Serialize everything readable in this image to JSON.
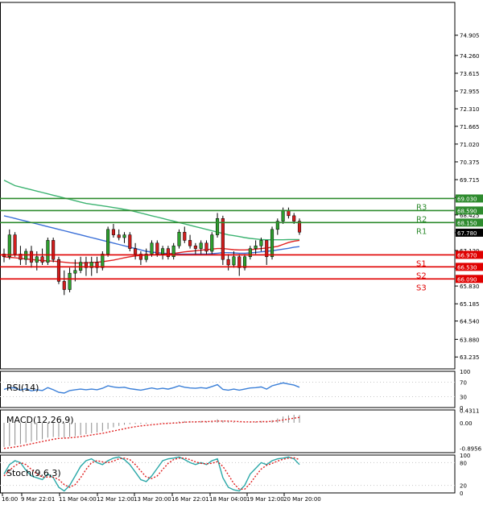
{
  "chart_data": [
    {
      "type": "candlestick",
      "ylim": [
        62.8,
        76.2
      ],
      "ticks": [
        75.0,
        74.26,
        73.61,
        72.96,
        72.31,
        71.67,
        71.02,
        70.37,
        69.72,
        69.07,
        68.43,
        67.78,
        67.13,
        66.48,
        65.83,
        65.18,
        64.55,
        63.88,
        63.235
      ],
      "tick_labels": [
        "74.905",
        "74.260",
        "73.615",
        "72.955",
        "72.310",
        "71.665",
        "71.020",
        "70.375",
        "69.715",
        "69.070",
        "68.425",
        "67.780",
        "67.120",
        "66.475",
        "65.830",
        "65.185",
        "64.540",
        "63.880",
        "63.235"
      ],
      "current_price": {
        "label": "67.780",
        "value": 67.78
      },
      "pivots": [
        {
          "name": "R3",
          "label": "69.030",
          "value": 69.03,
          "color": "#2e8b2e"
        },
        {
          "name": "R2",
          "label": "68.590",
          "value": 68.59,
          "color": "#2e8b2e"
        },
        {
          "name": "R1",
          "label": "68.150",
          "value": 68.15,
          "color": "#2e8b2e"
        },
        {
          "name": "S1",
          "label": "66.970",
          "value": 66.97,
          "color": "#e00000"
        },
        {
          "name": "S2",
          "label": "66.530",
          "value": 66.53,
          "color": "#e00000"
        },
        {
          "name": "S3",
          "label": "66.090",
          "value": 66.09,
          "color": "#e00000"
        }
      ],
      "x_labels": [
        "16:00",
        "9 Mar 22:01",
        "11 Mar 04:00",
        "12 Mar 12:00",
        "13 Mar 20:00",
        "16 Mar 22:01",
        "18 Mar 04:00",
        "19 Mar 12:00",
        "20 Mar 20:00"
      ],
      "candles": [
        [
          67.0,
          67.2,
          66.7,
          66.9
        ],
        [
          66.9,
          67.9,
          66.8,
          67.7
        ],
        [
          67.7,
          67.8,
          66.9,
          67.0
        ],
        [
          67.0,
          67.3,
          66.6,
          66.8
        ],
        [
          66.8,
          67.2,
          66.6,
          67.1
        ],
        [
          67.1,
          67.3,
          66.5,
          66.7
        ],
        [
          66.7,
          67.1,
          66.4,
          66.9
        ],
        [
          66.9,
          67.2,
          66.6,
          66.7
        ],
        [
          66.7,
          67.6,
          66.6,
          67.5
        ],
        [
          67.5,
          67.6,
          66.7,
          66.8
        ],
        [
          66.8,
          66.9,
          65.9,
          66.0
        ],
        [
          66.0,
          66.4,
          65.5,
          65.7
        ],
        [
          65.7,
          66.5,
          65.6,
          66.3
        ],
        [
          66.3,
          66.8,
          66.0,
          66.4
        ],
        [
          66.4,
          66.9,
          66.3,
          66.7
        ],
        [
          66.7,
          66.9,
          66.2,
          66.5
        ],
        [
          66.5,
          66.9,
          66.2,
          66.7
        ],
        [
          66.7,
          66.9,
          66.3,
          66.5
        ],
        [
          66.5,
          67.1,
          66.4,
          67.0
        ],
        [
          67.0,
          68.0,
          66.9,
          67.9
        ],
        [
          67.9,
          68.1,
          67.6,
          67.7
        ],
        [
          67.7,
          67.9,
          67.5,
          67.6
        ],
        [
          67.6,
          67.8,
          67.4,
          67.7
        ],
        [
          67.7,
          67.8,
          67.1,
          67.2
        ],
        [
          67.2,
          67.4,
          66.8,
          67.0
        ],
        [
          67.0,
          67.1,
          66.6,
          66.8
        ],
        [
          66.8,
          67.2,
          66.7,
          67.0
        ],
        [
          67.0,
          67.5,
          66.9,
          67.4
        ],
        [
          67.4,
          67.5,
          66.9,
          67.0
        ],
        [
          67.0,
          67.3,
          66.8,
          67.2
        ],
        [
          67.2,
          67.3,
          66.8,
          66.9
        ],
        [
          66.9,
          67.4,
          66.8,
          67.3
        ],
        [
          67.3,
          67.9,
          67.2,
          67.8
        ],
        [
          67.8,
          68.0,
          67.4,
          67.5
        ],
        [
          67.5,
          67.7,
          67.2,
          67.3
        ],
        [
          67.3,
          67.4,
          67.0,
          67.2
        ],
        [
          67.2,
          67.5,
          67.0,
          67.4
        ],
        [
          67.4,
          67.5,
          67.0,
          67.1
        ],
        [
          67.1,
          67.8,
          67.0,
          67.7
        ],
        [
          67.7,
          68.5,
          67.6,
          68.3
        ],
        [
          68.3,
          68.4,
          66.6,
          66.8
        ],
        [
          66.8,
          67.0,
          66.4,
          66.6
        ],
        [
          66.6,
          67.1,
          66.5,
          66.9
        ],
        [
          66.9,
          67.0,
          66.2,
          66.5
        ],
        [
          66.5,
          67.0,
          66.4,
          66.9
        ],
        [
          66.9,
          67.3,
          66.8,
          67.2
        ],
        [
          67.2,
          67.5,
          67.0,
          67.3
        ],
        [
          67.3,
          67.6,
          67.1,
          67.5
        ],
        [
          67.5,
          67.5,
          66.6,
          66.9
        ],
        [
          66.9,
          68.0,
          66.8,
          67.9
        ],
        [
          67.9,
          68.3,
          67.7,
          68.2
        ],
        [
          68.2,
          68.7,
          68.1,
          68.6
        ],
        [
          68.6,
          68.7,
          68.3,
          68.4
        ],
        [
          68.4,
          68.5,
          68.1,
          68.2
        ],
        [
          68.2,
          68.3,
          67.7,
          67.8
        ]
      ],
      "ma_green": [
        69.7,
        69.6,
        69.5,
        69.45,
        69.4,
        69.35,
        69.3,
        69.25,
        69.2,
        69.15,
        69.1,
        69.05,
        69.0,
        68.95,
        68.9,
        68.85,
        68.82,
        68.79,
        68.76,
        68.73,
        68.7,
        68.67,
        68.63,
        68.6,
        68.55,
        68.5,
        68.45,
        68.4,
        68.35,
        68.3,
        68.25,
        68.2,
        68.15,
        68.1,
        68.05,
        68.0,
        67.95,
        67.9,
        67.85,
        67.8,
        67.75,
        67.7,
        67.67,
        67.64,
        67.6,
        67.57,
        67.55,
        67.53,
        67.52,
        67.52,
        67.52,
        67.52,
        67.53,
        67.53,
        67.53
      ],
      "ma_blue": [
        68.4,
        68.35,
        68.3,
        68.25,
        68.2,
        68.15,
        68.1,
        68.05,
        68.0,
        67.95,
        67.9,
        67.85,
        67.8,
        67.75,
        67.7,
        67.65,
        67.6,
        67.55,
        67.5,
        67.45,
        67.4,
        67.35,
        67.3,
        67.25,
        67.2,
        67.15,
        67.1,
        67.07,
        67.05,
        67.03,
        67.02,
        67.01,
        67.0,
        67.0,
        67.0,
        67.0,
        67.0,
        67.0,
        67.01,
        67.03,
        67.05,
        67.05,
        67.04,
        67.03,
        67.03,
        67.04,
        67.06,
        67.08,
        67.1,
        67.12,
        67.15,
        67.18,
        67.21,
        67.25,
        67.27
      ],
      "ma_red": [
        66.9,
        66.88,
        66.86,
        66.84,
        66.82,
        66.8,
        66.78,
        66.76,
        66.75,
        66.74,
        66.72,
        66.7,
        66.68,
        66.67,
        66.67,
        66.68,
        66.69,
        66.7,
        66.72,
        66.75,
        66.78,
        66.82,
        66.86,
        66.9,
        66.93,
        66.95,
        66.96,
        66.97,
        66.98,
        66.99,
        67.0,
        67.02,
        67.05,
        67.08,
        67.1,
        67.12,
        67.14,
        67.16,
        67.18,
        67.2,
        67.2,
        67.18,
        67.16,
        67.15,
        67.15,
        67.16,
        67.18,
        67.2,
        67.22,
        67.25,
        67.28,
        67.35,
        67.42,
        67.47,
        67.5
      ]
    },
    {
      "type": "line",
      "title": "RSI(14)",
      "ylim": [
        0,
        100
      ],
      "tick_labels": [
        "100",
        "70",
        "30",
        "0"
      ],
      "values": [
        50,
        55,
        54,
        48,
        52,
        46,
        49,
        47,
        55,
        49,
        42,
        40,
        47,
        49,
        51,
        49,
        51,
        49,
        53,
        60,
        57,
        55,
        56,
        52,
        50,
        48,
        51,
        54,
        51,
        53,
        51,
        55,
        60,
        56,
        54,
        53,
        55,
        53,
        58,
        63,
        50,
        48,
        51,
        48,
        51,
        54,
        55,
        57,
        51,
        60,
        64,
        68,
        65,
        62,
        56
      ]
    },
    {
      "type": "bar",
      "title": "MACD(12,26,9)",
      "ylim": [
        -1.05,
        0.45
      ],
      "tick_labels": [
        "0.4311",
        "0.00",
        "-0.8956"
      ],
      "values": [
        -0.85,
        -0.82,
        -0.78,
        -0.75,
        -0.7,
        -0.66,
        -0.62,
        -0.58,
        -0.52,
        -0.5,
        -0.5,
        -0.52,
        -0.5,
        -0.47,
        -0.43,
        -0.4,
        -0.37,
        -0.34,
        -0.3,
        -0.22,
        -0.16,
        -0.11,
        -0.07,
        -0.05,
        -0.04,
        -0.04,
        -0.03,
        -0.01,
        0.0,
        0.01,
        0.01,
        0.02,
        0.05,
        0.06,
        0.06,
        0.05,
        0.06,
        0.05,
        0.07,
        0.12,
        0.08,
        0.04,
        0.03,
        0.01,
        0.01,
        0.02,
        0.04,
        0.06,
        0.05,
        0.09,
        0.15,
        0.22,
        0.26,
        0.28,
        0.27
      ],
      "signal": [
        -0.9,
        -0.88,
        -0.85,
        -0.82,
        -0.78,
        -0.74,
        -0.7,
        -0.66,
        -0.62,
        -0.58,
        -0.55,
        -0.54,
        -0.53,
        -0.51,
        -0.49,
        -0.46,
        -0.43,
        -0.4,
        -0.37,
        -0.33,
        -0.29,
        -0.25,
        -0.21,
        -0.17,
        -0.14,
        -0.11,
        -0.09,
        -0.07,
        -0.05,
        -0.03,
        -0.02,
        -0.01,
        0.0,
        0.02,
        0.03,
        0.03,
        0.04,
        0.04,
        0.05,
        0.06,
        0.06,
        0.06,
        0.05,
        0.04,
        0.03,
        0.03,
        0.03,
        0.04,
        0.04,
        0.05,
        0.07,
        0.1,
        0.13,
        0.16,
        0.19
      ]
    },
    {
      "type": "line",
      "title": "Stoch(9,6,3)",
      "ylim": [
        0,
        100
      ],
      "tick_labels": [
        "100",
        "80",
        "20",
        "0"
      ],
      "k": [
        50,
        75,
        85,
        80,
        60,
        45,
        40,
        35,
        50,
        40,
        15,
        5,
        20,
        45,
        70,
        85,
        90,
        80,
        75,
        85,
        92,
        95,
        88,
        75,
        55,
        35,
        30,
        45,
        65,
        85,
        90,
        92,
        95,
        88,
        80,
        75,
        80,
        75,
        85,
        90,
        40,
        15,
        8,
        5,
        20,
        50,
        65,
        80,
        75,
        85,
        90,
        92,
        95,
        90,
        75
      ],
      "d": [
        45,
        60,
        72,
        80,
        75,
        62,
        50,
        42,
        42,
        42,
        35,
        22,
        15,
        22,
        40,
        62,
        80,
        85,
        82,
        80,
        84,
        90,
        92,
        88,
        75,
        58,
        42,
        38,
        45,
        62,
        78,
        88,
        92,
        92,
        88,
        82,
        78,
        77,
        78,
        83,
        70,
        48,
        25,
        10,
        10,
        25,
        45,
        63,
        73,
        78,
        84,
        89,
        92,
        93,
        88
      ]
    }
  ]
}
